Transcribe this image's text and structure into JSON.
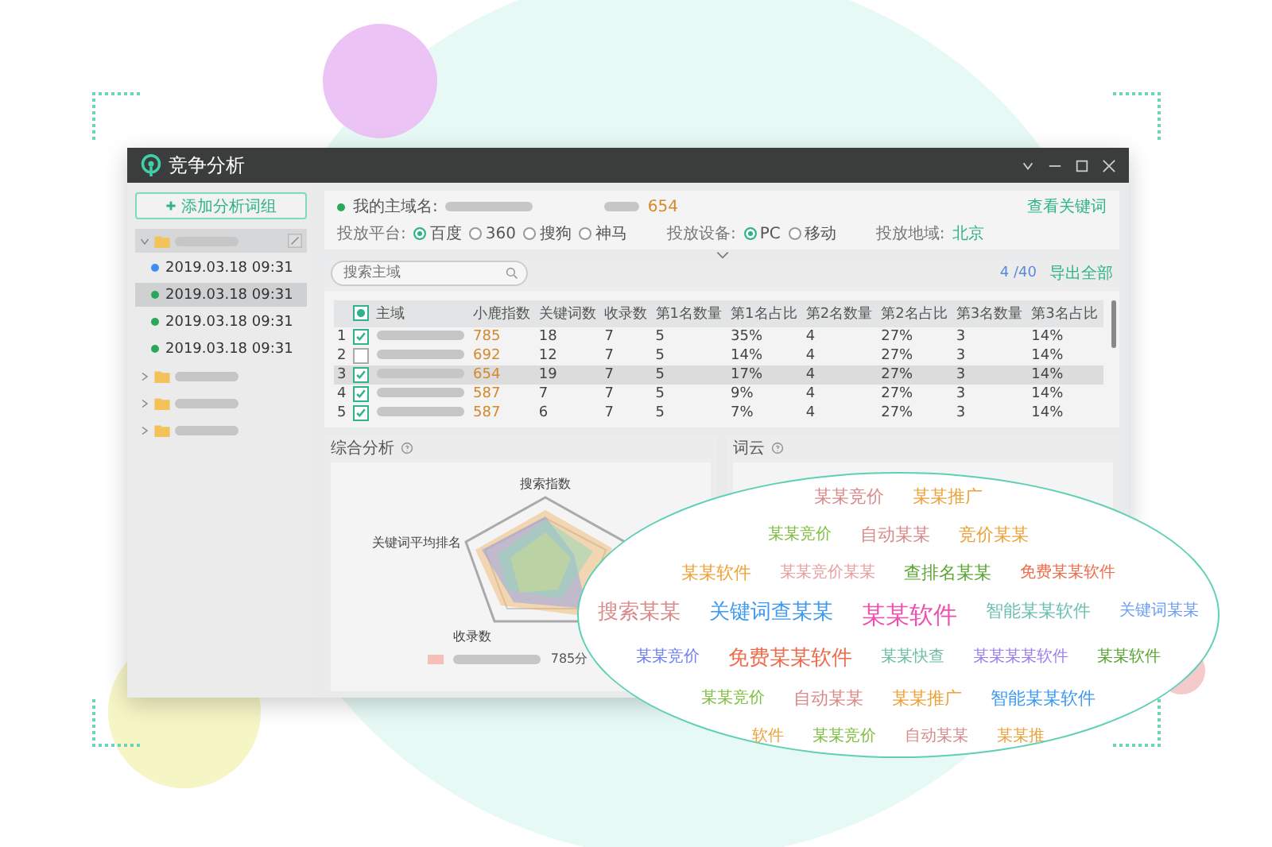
{
  "window": {
    "title": "竞争分析"
  },
  "sidebar": {
    "add_button": "添加分析词组",
    "groups": [
      {
        "expanded": true,
        "children": [
          {
            "label": "2019.03.18 09:31",
            "color": "#3d8ef0",
            "selected": false
          },
          {
            "label": "2019.03.18 09:31",
            "color": "#2aa85a",
            "selected": true
          },
          {
            "label": "2019.03.18 09:31",
            "color": "#2aa85a",
            "selected": false
          },
          {
            "label": "2019.03.18 09:31",
            "color": "#2aa85a",
            "selected": false
          }
        ]
      },
      {
        "expanded": false
      },
      {
        "expanded": false
      },
      {
        "expanded": false
      }
    ]
  },
  "info": {
    "domain_label": "我的主域名:",
    "score": "654",
    "view_keywords": "查看关键词",
    "platform_label": "投放平台:",
    "platforms": [
      {
        "label": "百度",
        "selected": true
      },
      {
        "label": "360",
        "selected": false
      },
      {
        "label": "搜狗",
        "selected": false
      },
      {
        "label": "神马",
        "selected": false
      }
    ],
    "device_label": "投放设备:",
    "devices": [
      {
        "label": "PC",
        "selected": true
      },
      {
        "label": "移动",
        "selected": false
      }
    ],
    "region_label": "投放地域:",
    "region": "北京"
  },
  "search": {
    "placeholder": "搜索主域"
  },
  "count": "4 /40",
  "export": "导出全部",
  "table": {
    "select_all_partial": true,
    "domain_header": "主域",
    "columns": [
      "小鹿指数",
      "关键词数",
      "收录数",
      "第1名数量",
      "第1名占比",
      "第2名数量",
      "第2名占比",
      "第3名数量",
      "第3名占比"
    ],
    "rows": [
      {
        "index": "1",
        "checked": true,
        "selected": false,
        "cells": [
          "785",
          "18",
          "7",
          "5",
          "35%",
          "4",
          "27%",
          "3",
          "14%"
        ]
      },
      {
        "index": "2",
        "checked": false,
        "selected": false,
        "cells": [
          "692",
          "12",
          "7",
          "5",
          "14%",
          "4",
          "27%",
          "3",
          "14%"
        ]
      },
      {
        "index": "3",
        "checked": true,
        "selected": true,
        "cells": [
          "654",
          "19",
          "7",
          "5",
          "17%",
          "4",
          "27%",
          "3",
          "14%"
        ]
      },
      {
        "index": "4",
        "checked": true,
        "selected": false,
        "cells": [
          "587",
          "7",
          "7",
          "5",
          "9%",
          "4",
          "27%",
          "3",
          "14%"
        ]
      },
      {
        "index": "5",
        "checked": true,
        "selected": false,
        "cells": [
          "587",
          "6",
          "7",
          "5",
          "7%",
          "4",
          "27%",
          "3",
          "14%"
        ]
      }
    ]
  },
  "analysis": {
    "title": "综合分析",
    "axes": [
      "搜索指数",
      "关键词平均排名",
      "收录数"
    ],
    "legend_score": "785分"
  },
  "cloud": {
    "title": "词云",
    "rows": [
      [
        {
          "text": "某某竞价",
          "color": "#d98b8b",
          "kind": "normal"
        },
        {
          "text": "某某推广",
          "color": "#eea23a",
          "kind": "normal"
        }
      ],
      [
        {
          "text": "某某竞价",
          "color": "#7fbf3f",
          "kind": "small"
        },
        {
          "text": "自动某某",
          "color": "#d98b8b",
          "kind": "normal"
        },
        {
          "text": "竞价某某",
          "color": "#eea23a",
          "kind": "normal"
        }
      ],
      [
        {
          "text": "某某软件",
          "color": "#eea23a",
          "kind": "normal"
        },
        {
          "text": "某某竞价某某",
          "color": "#eaa0a0",
          "kind": "small"
        },
        {
          "text": "查排名某某",
          "color": "#5aa532",
          "kind": "normal"
        },
        {
          "text": "免费某某软件",
          "color": "#f06b4a",
          "kind": "small"
        }
      ],
      [
        {
          "text": "搜索某某",
          "color": "#d98b8b",
          "kind": "large"
        },
        {
          "text": "关键词查某某",
          "color": "#3d9af0",
          "kind": "large"
        },
        {
          "text": "某某软件",
          "color": "#f050b0",
          "kind": "huge"
        },
        {
          "text": "智能某某软件",
          "color": "#6cc0b0",
          "kind": "normal"
        },
        {
          "text": "关键词某某",
          "color": "#6f9ff5",
          "kind": "small"
        }
      ],
      [
        {
          "text": "某某竞价",
          "color": "#6f7ff5",
          "kind": "small"
        },
        {
          "text": "免费某某软件",
          "color": "#f06b4a",
          "kind": "large"
        },
        {
          "text": "某某快查",
          "color": "#6cc0a0",
          "kind": "small"
        },
        {
          "text": "某某某某软件",
          "color": "#9b7ff0",
          "kind": "small"
        },
        {
          "text": "某某软件",
          "color": "#5aa532",
          "kind": "small"
        }
      ],
      [
        {
          "text": "某某竞价",
          "color": "#7fbf3f",
          "kind": "small"
        },
        {
          "text": "自动某某",
          "color": "#d98b8b",
          "kind": "normal"
        },
        {
          "text": "某某推广",
          "color": "#eea23a",
          "kind": "normal"
        },
        {
          "text": "智能某某软件",
          "color": "#3d9af0",
          "kind": "normal"
        }
      ],
      [
        {
          "text": "软件",
          "color": "#eea23a",
          "kind": "small"
        },
        {
          "text": "某某竞价",
          "color": "#7fbf3f",
          "kind": "small"
        },
        {
          "text": "自动某某",
          "color": "#d98b8b",
          "kind": "small"
        },
        {
          "text": "某某推",
          "color": "#eea23a",
          "kind": "small"
        }
      ]
    ]
  }
}
